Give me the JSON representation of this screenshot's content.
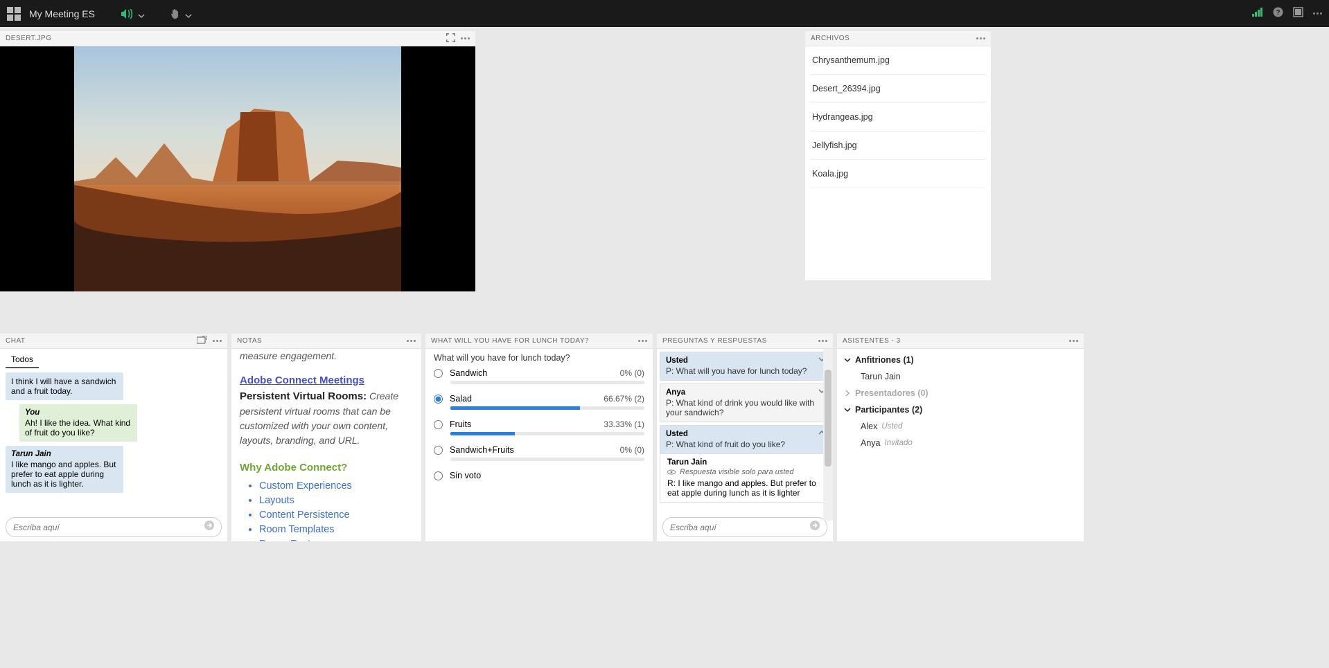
{
  "topbar": {
    "title": "My Meeting ES"
  },
  "share": {
    "title": "DESERT.JPG"
  },
  "files": {
    "title": "ARCHIVOS",
    "items": [
      "Chrysanthemum.jpg",
      "Desert_26394.jpg",
      "Hydrangeas.jpg",
      "Jellyfish.jpg",
      "Koala.jpg"
    ]
  },
  "chat": {
    "title": "CHAT",
    "tab": "Todos",
    "placeholder": "Escriba aquí",
    "messages": [
      {
        "from": "",
        "text": "I think I will have a sandwich and a fruit today.",
        "cls": "other"
      },
      {
        "from": "You",
        "text": "Ah! I like the idea. What kind of fruit do you like?",
        "cls": "me"
      },
      {
        "from": "Tarun Jain",
        "text": "I like mango and apples. But prefer to eat apple during lunch as it is lighter.",
        "cls": "other"
      }
    ]
  },
  "notes": {
    "title": "NOTAS",
    "intro_italic": "measure engagement.",
    "link": "Adobe Connect Meetings",
    "sub_bold": "Persistent Virtual Rooms:",
    "sub_italic": "Create persistent virtual rooms that can be customized with your own content, layouts, branding, and URL.",
    "why": "Why Adobe Connect?",
    "bullets": [
      "Custom Experiences",
      "Layouts",
      "Content Persistence",
      "Room Templates",
      "Power Features"
    ]
  },
  "poll": {
    "title": "WHAT WILL YOU HAVE FOR LUNCH TODAY?",
    "question": "What will you have for lunch today?",
    "options": [
      {
        "label": "Sandwich",
        "pct": "0% (0)",
        "bar": 0,
        "checked": false
      },
      {
        "label": "Salad",
        "pct": "66.67% (2)",
        "bar": 66.67,
        "checked": true
      },
      {
        "label": "Fruits",
        "pct": "33.33% (1)",
        "bar": 33.33,
        "checked": false
      },
      {
        "label": "Sandwich+Fruits",
        "pct": "0% (0)",
        "bar": 0,
        "checked": false
      },
      {
        "label": "Sin voto",
        "pct": "",
        "bar": null,
        "checked": false
      }
    ]
  },
  "qa": {
    "title": "PREGUNTAS Y RESPUESTAS",
    "placeholder": "Escriba aquí",
    "items": [
      {
        "name": "Usted",
        "q": "P: What will you have for lunch today?",
        "sel": true,
        "open": false
      },
      {
        "name": "Anya",
        "q": "P: What kind of drink you would like with your sandwich?",
        "sel": false,
        "open": false
      },
      {
        "name": "Usted",
        "q": "P: What kind of fruit do you like?",
        "sel": true,
        "open": true,
        "answer": {
          "name": "Tarun Jain",
          "vis": "Respuesta visible solo para usted",
          "text": "R: I like mango and apples. But prefer to eat apple during lunch as it is lighter"
        }
      }
    ]
  },
  "att": {
    "title": "ASISTENTES - 3",
    "groups": [
      {
        "label": "Anfitriones (1)",
        "open": true,
        "disabled": false,
        "rows": [
          {
            "name": "Tarun Jain",
            "tag": ""
          }
        ]
      },
      {
        "label": "Presentadores (0)",
        "open": false,
        "disabled": true,
        "rows": []
      },
      {
        "label": "Participantes (2)",
        "open": true,
        "disabled": false,
        "rows": [
          {
            "name": "Alex",
            "tag": "Usted"
          },
          {
            "name": "Anya",
            "tag": "Invitado"
          }
        ]
      }
    ]
  }
}
